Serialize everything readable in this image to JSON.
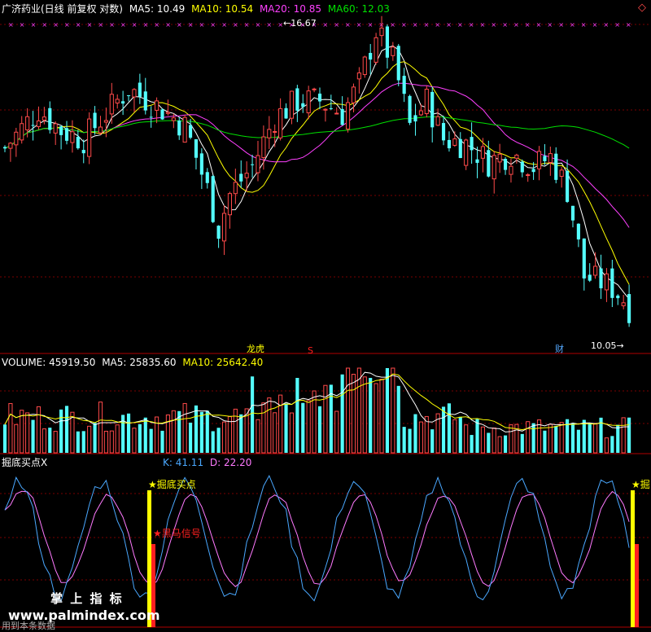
{
  "colors": {
    "up": "#ff4a4a",
    "down": "#54ffff",
    "ma5": "#ffffff",
    "ma10": "#ffff00",
    "ma20": "#ff40ff",
    "ma60": "#00e000",
    "k_line": "#4aa8ff",
    "d_line": "#ff7aff",
    "grid": "#7a0000",
    "label_white": "#ffffff",
    "signal_yellow": "#ffff00",
    "signal_red": "#ff2020"
  },
  "price_panel": {
    "title": "广济药业(日线 前复权 对数)",
    "ma5_label": "MA5: 10.49",
    "ma10_label": "MA10: 10.54",
    "ma20_label": "MA20: 10.85",
    "ma60_label": "MA60: 12.03",
    "high_annotation": "16.67",
    "low_annotation": "10.05",
    "event_tags": [
      "龙虎",
      "S",
      "财"
    ],
    "corner_icon": "diamond-icon"
  },
  "volume_panel": {
    "volume_label": "VOLUME: 45919.50",
    "ma5_label": "MA5: 25835.60",
    "ma10_label": "MA10: 25642.40"
  },
  "indicator_panel": {
    "name": "掘底买点X",
    "k_label": "K: 41.11",
    "d_label": "D: 22.20",
    "signal1": "掘底买点",
    "signal1_cut": "掘",
    "signal2": "黑马信号"
  },
  "watermark": {
    "brand": "掌 上 指 标",
    "url": "www.palmindex.com",
    "footer_text": "用到本条数据"
  },
  "chart_data": [
    {
      "type": "candlestick",
      "title": "广济药业(日线 前复权 对数)",
      "ylim": [
        10.0,
        17.0
      ],
      "y_scale": "log",
      "high": 16.67,
      "low": 10.05,
      "series": [
        {
          "name": "MA5",
          "last": 10.49
        },
        {
          "name": "MA10",
          "last": 10.54
        },
        {
          "name": "MA20",
          "last": 10.85
        },
        {
          "name": "MA60",
          "last": 12.03
        }
      ]
    },
    {
      "type": "bar",
      "title": "VOLUME",
      "series": [
        {
          "name": "VOLUME",
          "last": 45919.5
        },
        {
          "name": "MA5",
          "last": 25835.6
        },
        {
          "name": "MA10",
          "last": 25642.4
        }
      ]
    },
    {
      "type": "line",
      "title": "掘底买点X",
      "series": [
        {
          "name": "K",
          "last": 41.11
        },
        {
          "name": "D",
          "last": 22.2
        }
      ]
    }
  ]
}
